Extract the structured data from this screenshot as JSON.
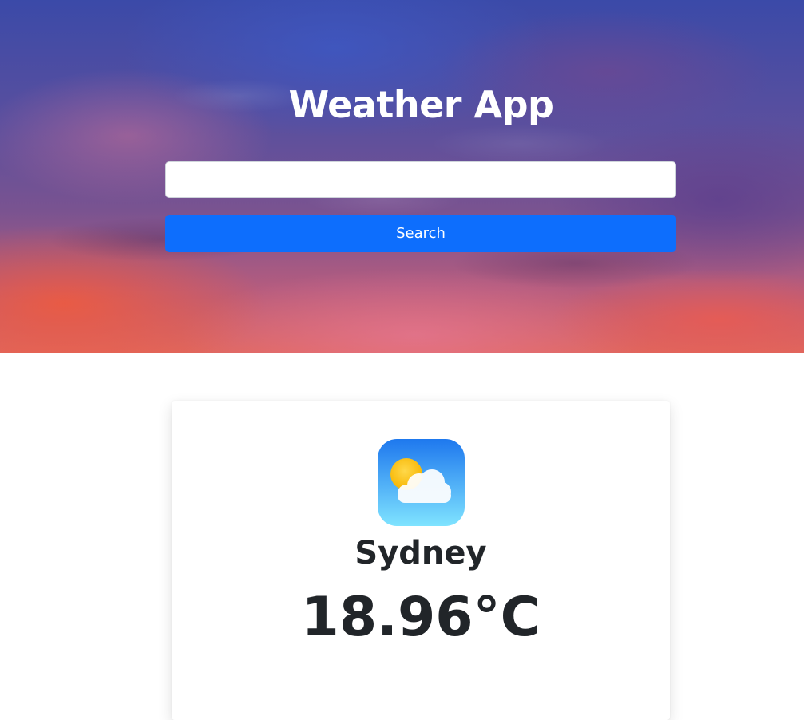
{
  "header": {
    "title": "Weather App"
  },
  "search": {
    "value": "",
    "placeholder": "",
    "button_label": "Search"
  },
  "weather": {
    "icon": "partly-cloudy-icon",
    "city": "Sydney",
    "temperature": "18.96°C"
  },
  "colors": {
    "button": "#0d6efd",
    "text": "#212529"
  }
}
